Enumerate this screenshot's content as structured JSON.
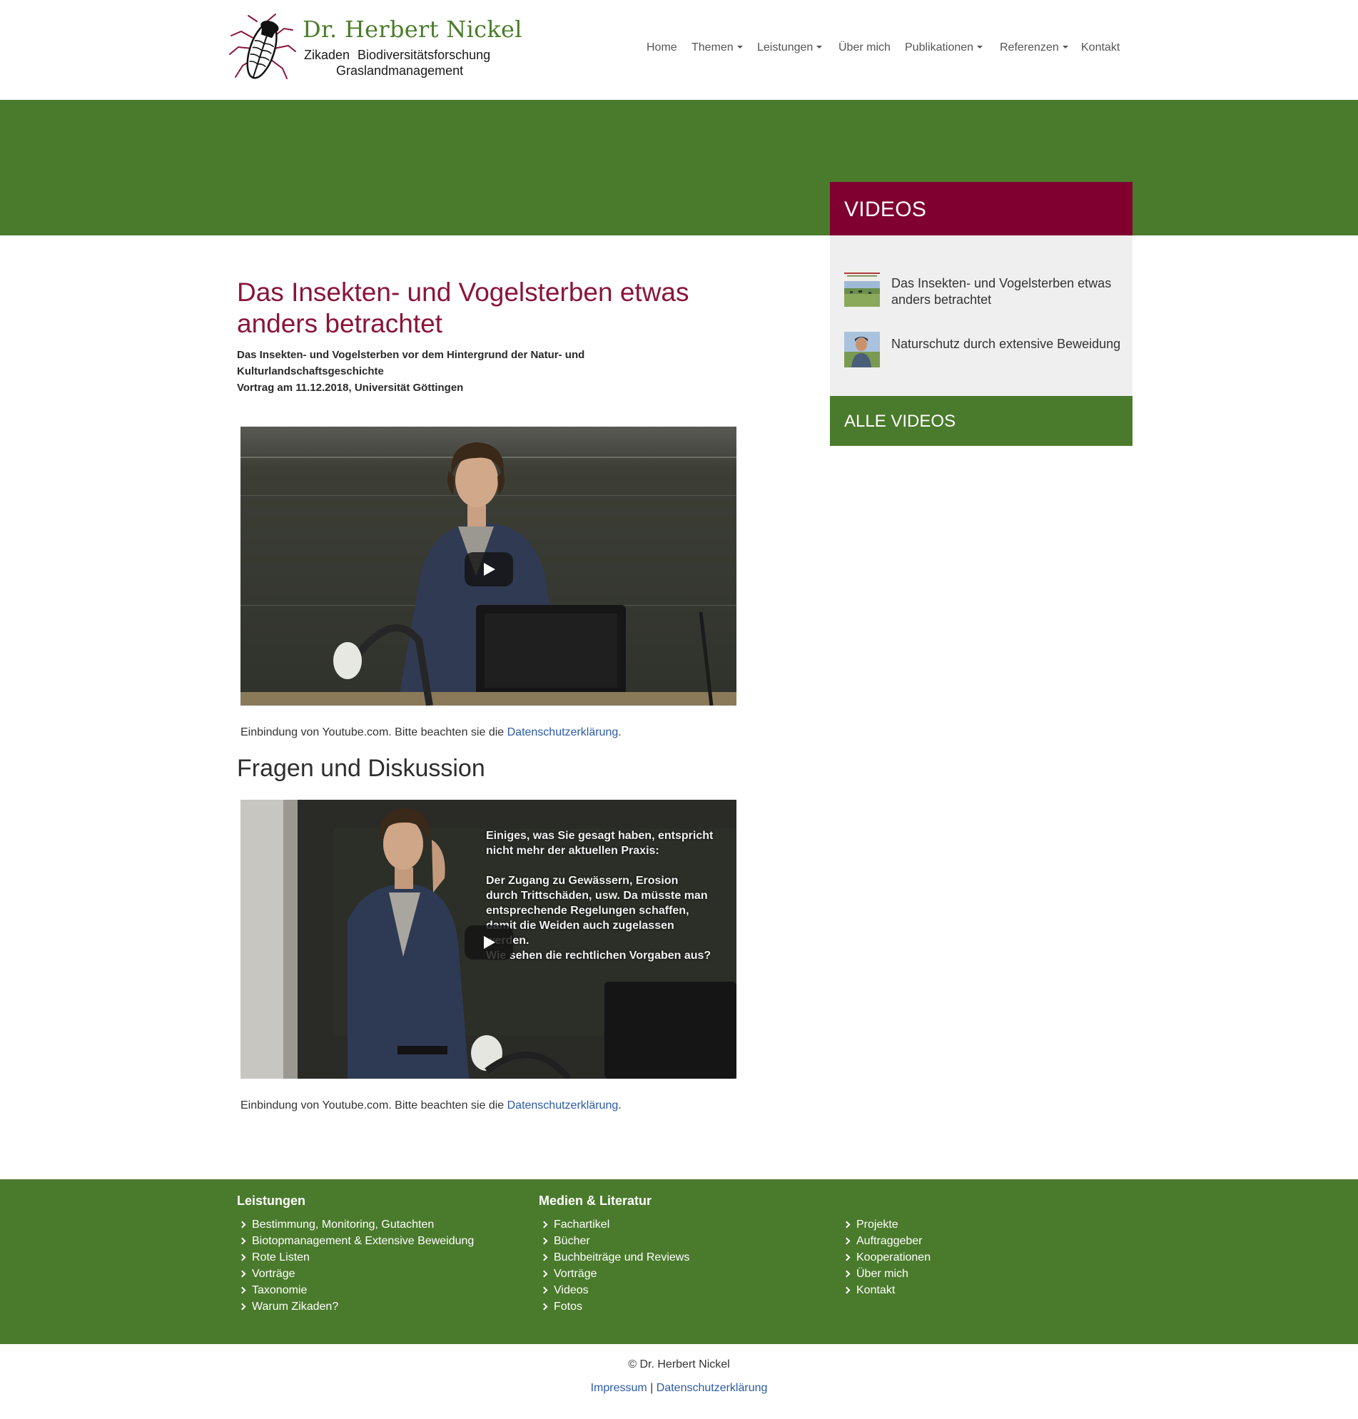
{
  "brand": {
    "name": "Dr. Herbert Nickel",
    "subline_1": "Zikaden  Biodiversitätsforschung",
    "subline_2": "Graslandmanagement"
  },
  "nav": {
    "home": "Home",
    "themen": "Themen",
    "leistungen": "Leistungen",
    "ueber": "Über mich",
    "publikationen": "Publikationen",
    "referenzen": "Referenzen",
    "kontakt": "Kontakt"
  },
  "sidebar": {
    "heading": "VIDEOS",
    "items": [
      {
        "label": "Das Insekten- und Vogelsterben etwas anders betrachtet"
      },
      {
        "label": "Naturschutz durch extensive Beweidung"
      }
    ],
    "footer_link": "ALLE VIDEOS"
  },
  "main": {
    "title": "Das Insekten- und Vogelsterben etwas anders betrachtet",
    "subtitle_line1": "Das Insekten- und Vogelsterben vor dem Hintergrund der Natur- und Kulturlandschaftsgeschichte",
    "subtitle_line2": "Vortrag am 11.12.2018, Universität Göttingen",
    "video1_caption": "Einbindung von Youtube.com. Bitte beachten sie die ",
    "privacy_link": "Datenschutzerklärung",
    "caption_end": ".",
    "section2_title": "Fragen und Diskussion",
    "video2_overlay": [
      "Einiges, was Sie gesagt haben, entspricht",
      "nicht mehr der aktuellen Praxis:",
      "",
      "Der Zugang zu Gewässern, Erosion",
      "durch Trittschäden, usw. Da müsste man",
      "entsprechende Regelungen schaffen,",
      "damit die Weiden auch zugelassen",
      "werden.",
      "Wie sehen die rechtlichen Vorgaben aus?"
    ],
    "video2_caption": "Einbindung von Youtube.com. Bitte beachten sie die "
  },
  "footer": {
    "col1_title": "Leistungen",
    "col1": [
      "Bestimmung, Monitoring, Gutachten",
      "Biotopmanagement & Extensive Beweidung",
      "Rote Listen",
      "Vorträge",
      "Taxonomie",
      "Warum Zikaden?"
    ],
    "col2_title": "Medien & Literatur",
    "col2": [
      "Fachartikel",
      "Bücher",
      "Buchbeiträge und Reviews",
      "Vorträge",
      "Videos",
      "Fotos"
    ],
    "col3": [
      "Projekte",
      "Auftraggeber",
      "Kooperationen",
      "Über mich",
      "Kontakt"
    ],
    "copyright": "© Dr. Herbert Nickel",
    "impressum": "Impressum",
    "separator": " | ",
    "datenschutz": "Datenschutzerklärung"
  },
  "colors": {
    "brand_green": "#4a7a2c",
    "accent_red": "#800030",
    "link_blue": "#2b5aa8"
  }
}
